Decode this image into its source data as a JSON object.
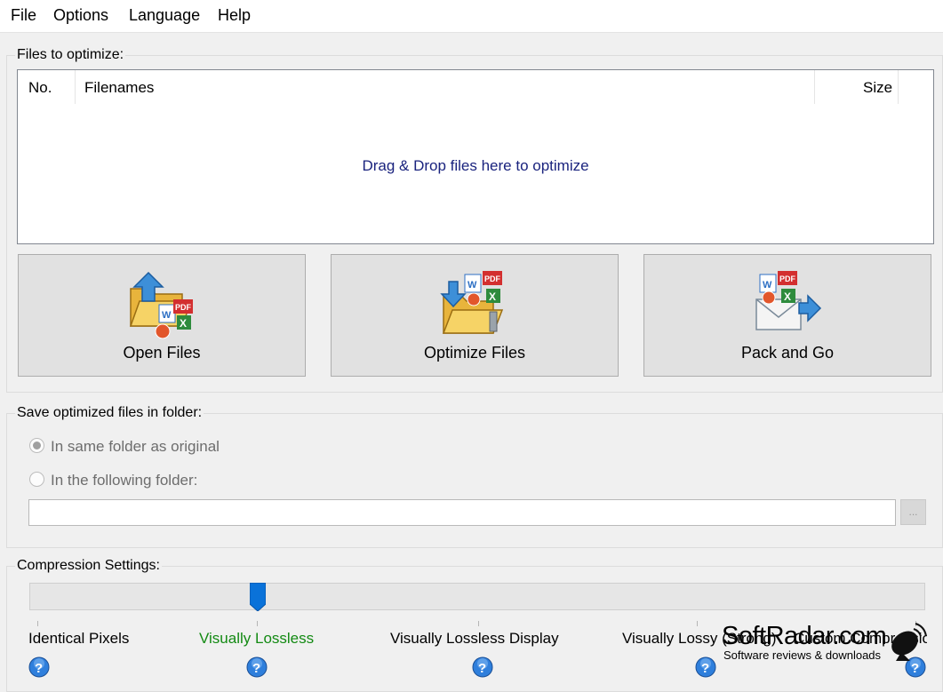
{
  "menu": [
    "File",
    "Options",
    "Language",
    "Help"
  ],
  "files_group": {
    "title": "Files to optimize:",
    "columns": [
      "No.",
      "Filenames",
      "Size"
    ],
    "drop_text": "Drag & Drop files here to optimize"
  },
  "buttons": {
    "open": "Open Files",
    "optimize": "Optimize Files",
    "pack": "Pack and Go"
  },
  "save_group": {
    "title": "Save optimized files in folder:",
    "option_same": "In same folder as original",
    "option_following": "In the following folder:",
    "selected": "same",
    "folder_value": "",
    "browse_label": "..."
  },
  "compression": {
    "title": "Compression Settings:",
    "levels": [
      "Identical Pixels",
      "Visually Lossless",
      "Visually Lossless Display",
      "Visually Lossy (Strong)",
      "Custom Compression"
    ],
    "selected_level": "Visually Lossless",
    "selected_color": "#138a13"
  },
  "watermark": {
    "main": "SoftRadar.com",
    "sub": "Software reviews & downloads"
  }
}
